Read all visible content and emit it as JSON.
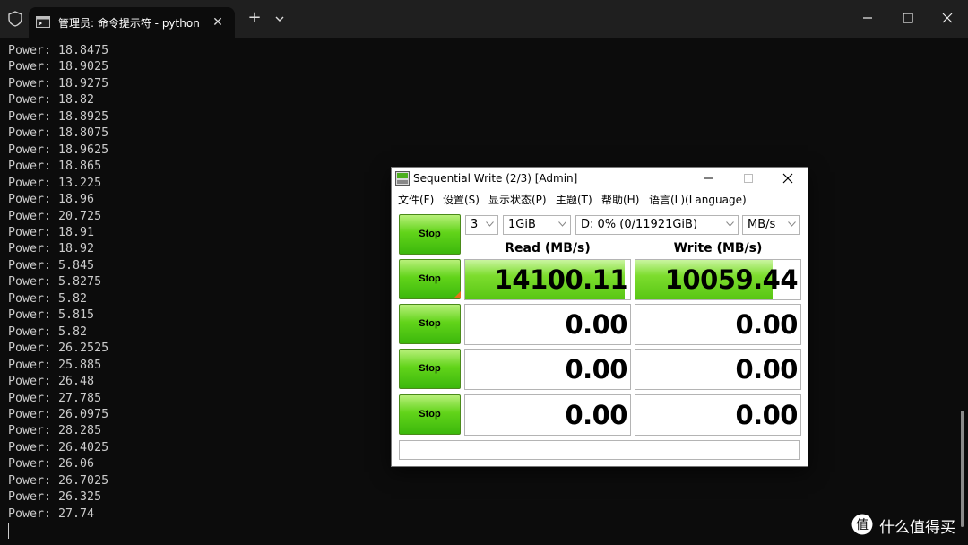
{
  "terminal": {
    "tab_title": "管理员: 命令提示符 - python",
    "tab_close": "✕",
    "new_tab": "+",
    "lines": [
      "Power: 18.8475",
      "Power: 18.9025",
      "Power: 18.9275",
      "Power: 18.82",
      "Power: 18.8925",
      "Power: 18.8075",
      "Power: 18.9625",
      "Power: 18.865",
      "Power: 13.225",
      "Power: 18.96",
      "Power: 20.725",
      "Power: 18.91",
      "Power: 18.92",
      "Power: 5.845",
      "Power: 5.8275",
      "Power: 5.82",
      "Power: 5.815",
      "Power: 5.82",
      "Power: 26.2525",
      "Power: 25.885",
      "Power: 26.48",
      "Power: 27.785",
      "Power: 26.0975",
      "Power: 28.285",
      "Power: 26.4025",
      "Power: 26.06",
      "Power: 26.7025",
      "Power: 26.325",
      "Power: 27.74"
    ]
  },
  "cdm": {
    "title": "Sequential Write (2/3) [Admin]",
    "menu": [
      "文件(F)",
      "设置(S)",
      "显示状态(P)",
      "主题(T)",
      "帮助(H)",
      "语言(L)(Language)"
    ],
    "controls": {
      "count": "3",
      "size": "1GiB",
      "drive": "D: 0% (0/11921GiB)",
      "unit": "MB/s"
    },
    "read_header": "Read (MB/s)",
    "write_header": "Write (MB/s)",
    "all_button": "Stop",
    "rows": [
      {
        "button": "Stop",
        "read": "14100.11",
        "write": "10059.44",
        "read_level": 0.97,
        "write_level": 0.83
      },
      {
        "button": "Stop",
        "read": "0.00",
        "write": "0.00",
        "read_level": 0,
        "write_level": 0
      },
      {
        "button": "Stop",
        "read": "0.00",
        "write": "0.00",
        "read_level": 0,
        "write_level": 0
      },
      {
        "button": "Stop",
        "read": "0.00",
        "write": "0.00",
        "read_level": 0,
        "write_level": 0
      }
    ],
    "status": ""
  },
  "watermark": {
    "icon": "值",
    "text": "什么值得买"
  },
  "colors": {
    "terminal_bg": "#0c0c0c",
    "terminal_text": "#cccccc",
    "button_green": "#62d41a",
    "bar_green": "#7ddd2e"
  }
}
